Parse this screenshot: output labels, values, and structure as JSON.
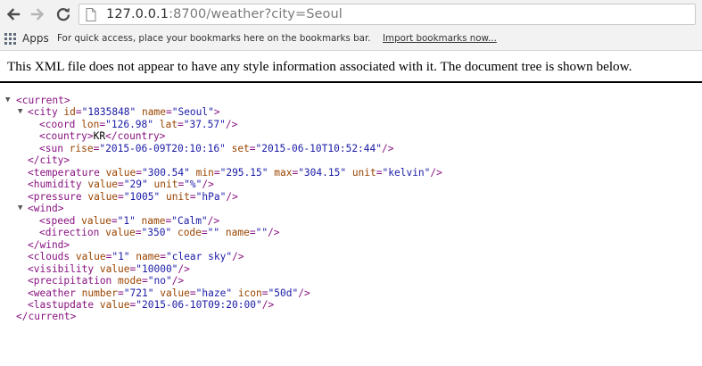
{
  "browser": {
    "url": {
      "host": "127.0.0.1",
      "port": ":8700",
      "path": "/weather?city=Seoul"
    }
  },
  "bookmarks_bar": {
    "apps_label": "Apps",
    "hint": "For quick access, place your bookmarks here on the bookmarks bar.",
    "import_link": "Import bookmarks now..."
  },
  "xml_viewer": {
    "header": "This XML file does not appear to have any style information associated with it. The document tree is shown below.",
    "lines": [
      {
        "indent": 1,
        "toggle": "▼",
        "text": "<current>"
      },
      {
        "indent": 2,
        "toggle": "▼",
        "text": "<city id=\"1835848\" name=\"Seoul\">"
      },
      {
        "indent": 3,
        "toggle": "",
        "text": "<coord lon=\"126.98\" lat=\"37.57\"/>"
      },
      {
        "indent": 3,
        "toggle": "",
        "text": "<country>KR</country>"
      },
      {
        "indent": 3,
        "toggle": "",
        "text": "<sun rise=\"2015-06-09T20:10:16\" set=\"2015-06-10T10:52:44\"/>"
      },
      {
        "indent": 2,
        "toggle": "",
        "text": "</city>"
      },
      {
        "indent": 2,
        "toggle": "",
        "text": "<temperature value=\"300.54\" min=\"295.15\" max=\"304.15\" unit=\"kelvin\"/>"
      },
      {
        "indent": 2,
        "toggle": "",
        "text": "<humidity value=\"29\" unit=\"%\"/>"
      },
      {
        "indent": 2,
        "toggle": "",
        "text": "<pressure value=\"1005\" unit=\"hPa\"/>"
      },
      {
        "indent": 2,
        "toggle": "▼",
        "text": "<wind>"
      },
      {
        "indent": 3,
        "toggle": "",
        "text": "<speed value=\"1\" name=\"Calm\"/>"
      },
      {
        "indent": 3,
        "toggle": "",
        "text": "<direction value=\"350\" code=\"\" name=\"\"/>"
      },
      {
        "indent": 2,
        "toggle": "",
        "text": "</wind>"
      },
      {
        "indent": 2,
        "toggle": "",
        "text": "<clouds value=\"1\" name=\"clear sky\"/>"
      },
      {
        "indent": 2,
        "toggle": "",
        "text": "<visibility value=\"10000\"/>"
      },
      {
        "indent": 2,
        "toggle": "",
        "text": "<precipitation mode=\"no\"/>"
      },
      {
        "indent": 2,
        "toggle": "",
        "text": "<weather number=\"721\" value=\"haze\" icon=\"50d\"/>"
      },
      {
        "indent": 2,
        "toggle": "",
        "text": "<lastupdate value=\"2015-06-10T09:20:00\"/>"
      },
      {
        "indent": 1,
        "toggle": "",
        "text": "</current>"
      }
    ]
  },
  "icons": {
    "back": "arrow-left-icon",
    "forward": "arrow-right-icon",
    "reload": "reload-icon",
    "page": "page-icon",
    "apps": "apps-grid-icon"
  },
  "colors": {
    "chrome_bg": "#f2f2f2",
    "tag": "#881280",
    "attr_name": "#994500",
    "attr_value": "#1a1aa6"
  }
}
